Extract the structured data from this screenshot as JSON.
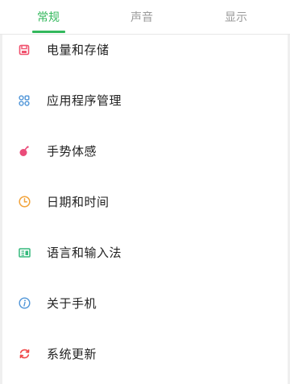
{
  "tabs": [
    {
      "label": "常规",
      "active": true
    },
    {
      "label": "声音",
      "active": false
    },
    {
      "label": "显示",
      "active": false
    }
  ],
  "settings": {
    "items": [
      {
        "label": "电量和存储",
        "icon": "storage-icon",
        "color": "#f0526e"
      },
      {
        "label": "应用程序管理",
        "icon": "apps-icon",
        "color": "#4f95d8"
      },
      {
        "label": "手势体感",
        "icon": "gesture-icon",
        "color": "#ea4c7a"
      },
      {
        "label": "日期和时间",
        "icon": "clock-icon",
        "color": "#f2a33a"
      },
      {
        "label": "语言和输入法",
        "icon": "language-icon",
        "color": "#34b97c"
      },
      {
        "label": "关于手机",
        "icon": "info-icon",
        "color": "#4f95d8"
      },
      {
        "label": "系统更新",
        "icon": "refresh-icon",
        "color": "#f04848"
      }
    ]
  },
  "colors": {
    "accent": "#33b85c",
    "inactive_tab": "#9a9a9a",
    "text": "#222222"
  }
}
